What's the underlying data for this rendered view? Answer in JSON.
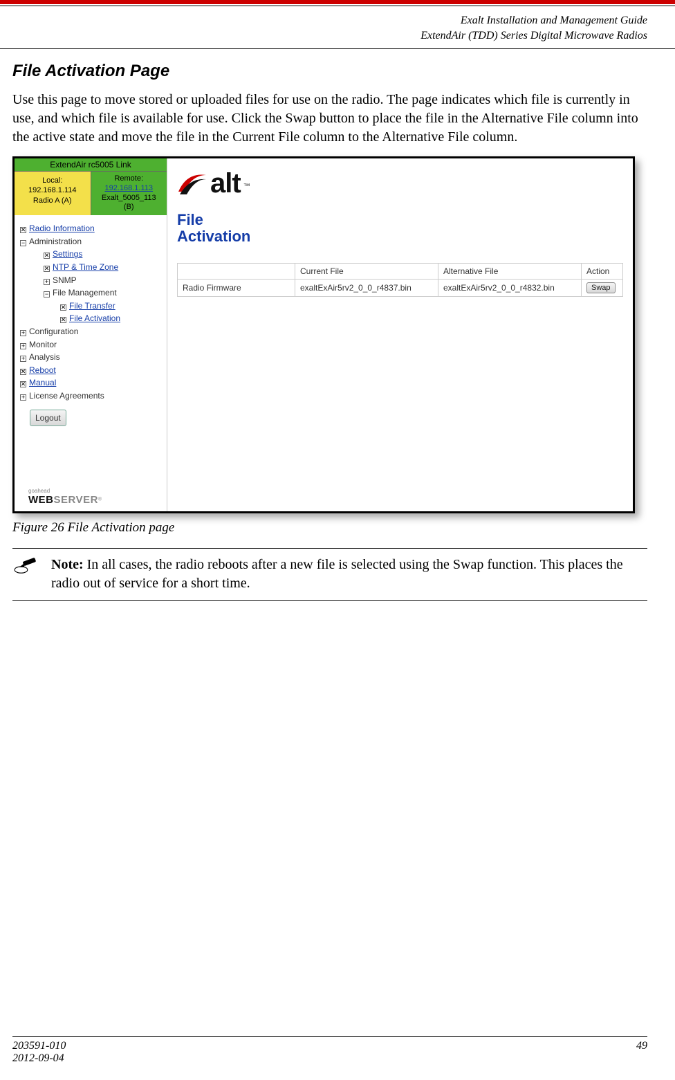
{
  "header": {
    "line1": "Exalt Installation and Management Guide",
    "line2": "ExtendAir (TDD) Series Digital Microwave Radios"
  },
  "section": {
    "title": "File Activation Page",
    "body": "Use this page to move stored or uploaded files for use on the radio. The page indicates which file is currently in use, and which file is available for use. Click the Swap button to place the file in the Alternative File column into the active state and move the file in the Current File column to the Alternative File column."
  },
  "screenshot": {
    "link_title": "ExtendAir rc5005 Link",
    "local": {
      "label": "Local:",
      "ip": "192.168.1.114",
      "radio": "Radio A (A)"
    },
    "remote": {
      "label": "Remote:",
      "ip": "192.168.1.113",
      "name": "Exalt_5005_113",
      "suffix": "(B)"
    },
    "nav": {
      "radio_info": "Radio Information",
      "administration": "Administration",
      "settings": "Settings",
      "ntp": "NTP & Time Zone",
      "snmp": "SNMP",
      "file_mgmt": "File Management",
      "file_transfer": "File Transfer",
      "file_activation": "File Activation",
      "configuration": "Configuration",
      "monitor": "Monitor",
      "analysis": "Analysis",
      "reboot": "Reboot",
      "manual": "Manual",
      "license": "License Agreements"
    },
    "logout": "Logout",
    "webserver": {
      "goahead": "goahead",
      "web": "WEB",
      "server": "SERVER"
    },
    "logo_text": "alt",
    "page_heading_l1": "File",
    "page_heading_l2": "Activation",
    "table": {
      "col_blank": "",
      "col_current": "Current File",
      "col_alt": "Alternative File",
      "col_action": "Action",
      "row_label": "Radio Firmware",
      "row_current": "exaltExAir5rv2_0_0_r4837.bin",
      "row_alt": "exaltExAir5rv2_0_0_r4832.bin",
      "swap": "Swap"
    }
  },
  "figure_caption": "Figure 26   File Activation page",
  "note": {
    "bold": "Note:",
    "text": " In all cases, the radio reboots after a new file is selected using the Swap function. This places the radio out of service for a short time."
  },
  "footer": {
    "docnum": "203591-010",
    "date": "2012-09-04",
    "page": "49"
  }
}
